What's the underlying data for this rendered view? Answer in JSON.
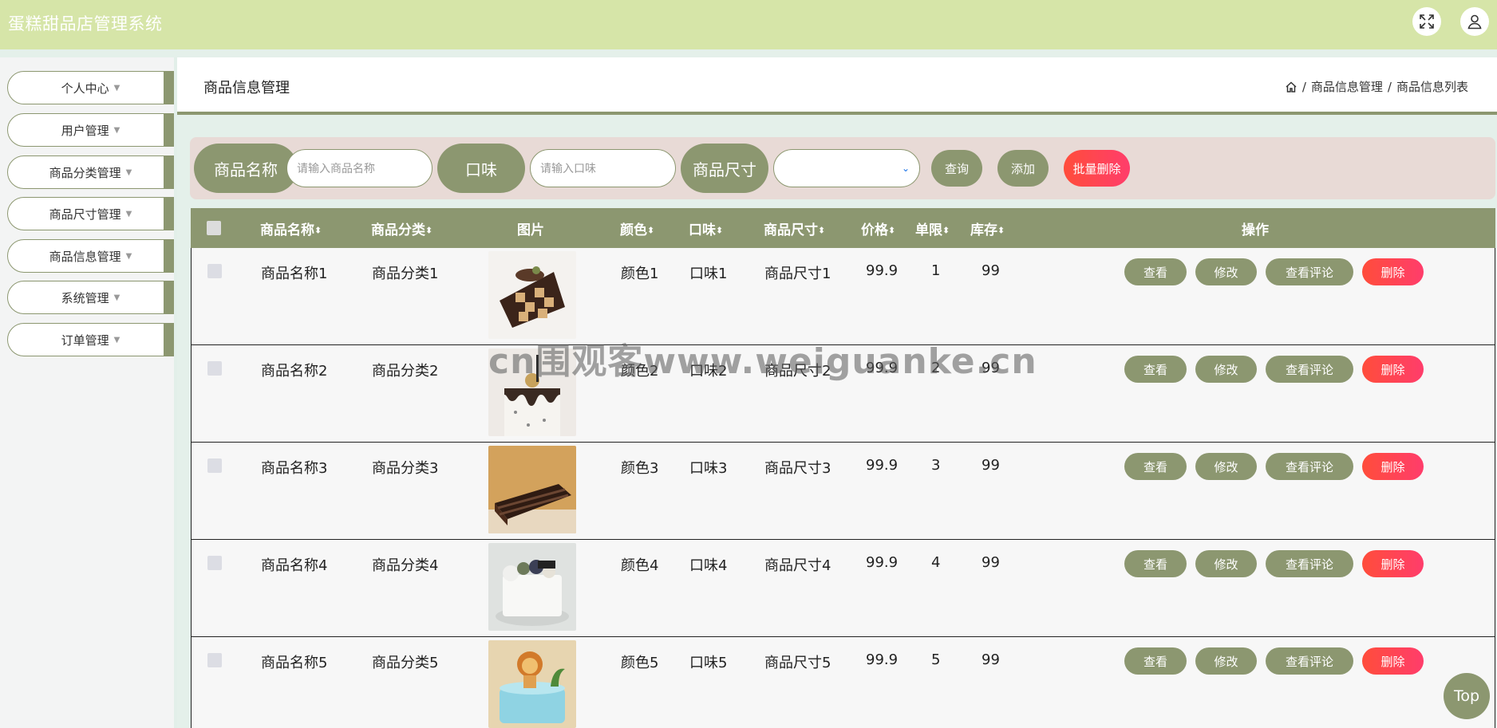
{
  "app": {
    "title": "蛋糕甜品店管理系统"
  },
  "header": {
    "icons": [
      "fullscreen-icon",
      "user-icon"
    ]
  },
  "sidebar": {
    "items": [
      {
        "label": "个人中心"
      },
      {
        "label": "用户管理"
      },
      {
        "label": "商品分类管理"
      },
      {
        "label": "商品尺寸管理"
      },
      {
        "label": "商品信息管理"
      },
      {
        "label": "系统管理"
      },
      {
        "label": "订单管理"
      }
    ]
  },
  "page": {
    "title": "商品信息管理",
    "breadcrumb": [
      "商品信息管理",
      "商品信息列表"
    ],
    "separator": "/"
  },
  "search": {
    "name_label": "商品名称",
    "name_placeholder": "请输入商品名称",
    "flavor_label": "口味",
    "flavor_placeholder": "请输入口味",
    "size_label": "商品尺寸",
    "size_value": "",
    "query_label": "查询",
    "add_label": "添加",
    "batch_delete_label": "批量删除"
  },
  "table": {
    "columns": [
      "商品名称",
      "商品分类",
      "图片",
      "颜色",
      "口味",
      "商品尺寸",
      "价格",
      "单限",
      "库存",
      "操作"
    ],
    "sort_glyph": "⬍",
    "actions": {
      "view": "查看",
      "edit": "修改",
      "comments": "查看评论",
      "delete": "删除"
    },
    "rows": [
      {
        "name": "商品名称1",
        "category": "商品分类1",
        "image": "cake-checkerboard",
        "color": "颜色1",
        "flavor": "口味1",
        "size": "商品尺寸1",
        "price": "99.9",
        "limit": "1",
        "stock": "99"
      },
      {
        "name": "商品名称2",
        "category": "商品分类2",
        "image": "cake-white-drip",
        "color": "颜色2",
        "flavor": "口味2",
        "size": "商品尺寸2",
        "price": "99.9",
        "limit": "2",
        "stock": "99"
      },
      {
        "name": "商品名称3",
        "category": "商品分类3",
        "image": "cake-chocolate-slice",
        "color": "颜色3",
        "flavor": "口味3",
        "size": "商品尺寸3",
        "price": "99.9",
        "limit": "3",
        "stock": "99"
      },
      {
        "name": "商品名称4",
        "category": "商品分类4",
        "image": "cake-floral",
        "color": "颜色4",
        "flavor": "口味4",
        "size": "商品尺寸4",
        "price": "99.9",
        "limit": "4",
        "stock": "99"
      },
      {
        "name": "商品名称5",
        "category": "商品分类5",
        "image": "cake-lion",
        "color": "颜色5",
        "flavor": "口味5",
        "size": "商品尺寸5",
        "price": "99.9",
        "limit": "5",
        "stock": "99"
      }
    ]
  },
  "watermark": "cn围观客www.weiguanke.cn",
  "back_to_top": "Top",
  "colors": {
    "olive": "#8c9770",
    "header": "#d6e5a8",
    "danger": "#ff4d4f",
    "search_panel": "#e8dad6"
  }
}
